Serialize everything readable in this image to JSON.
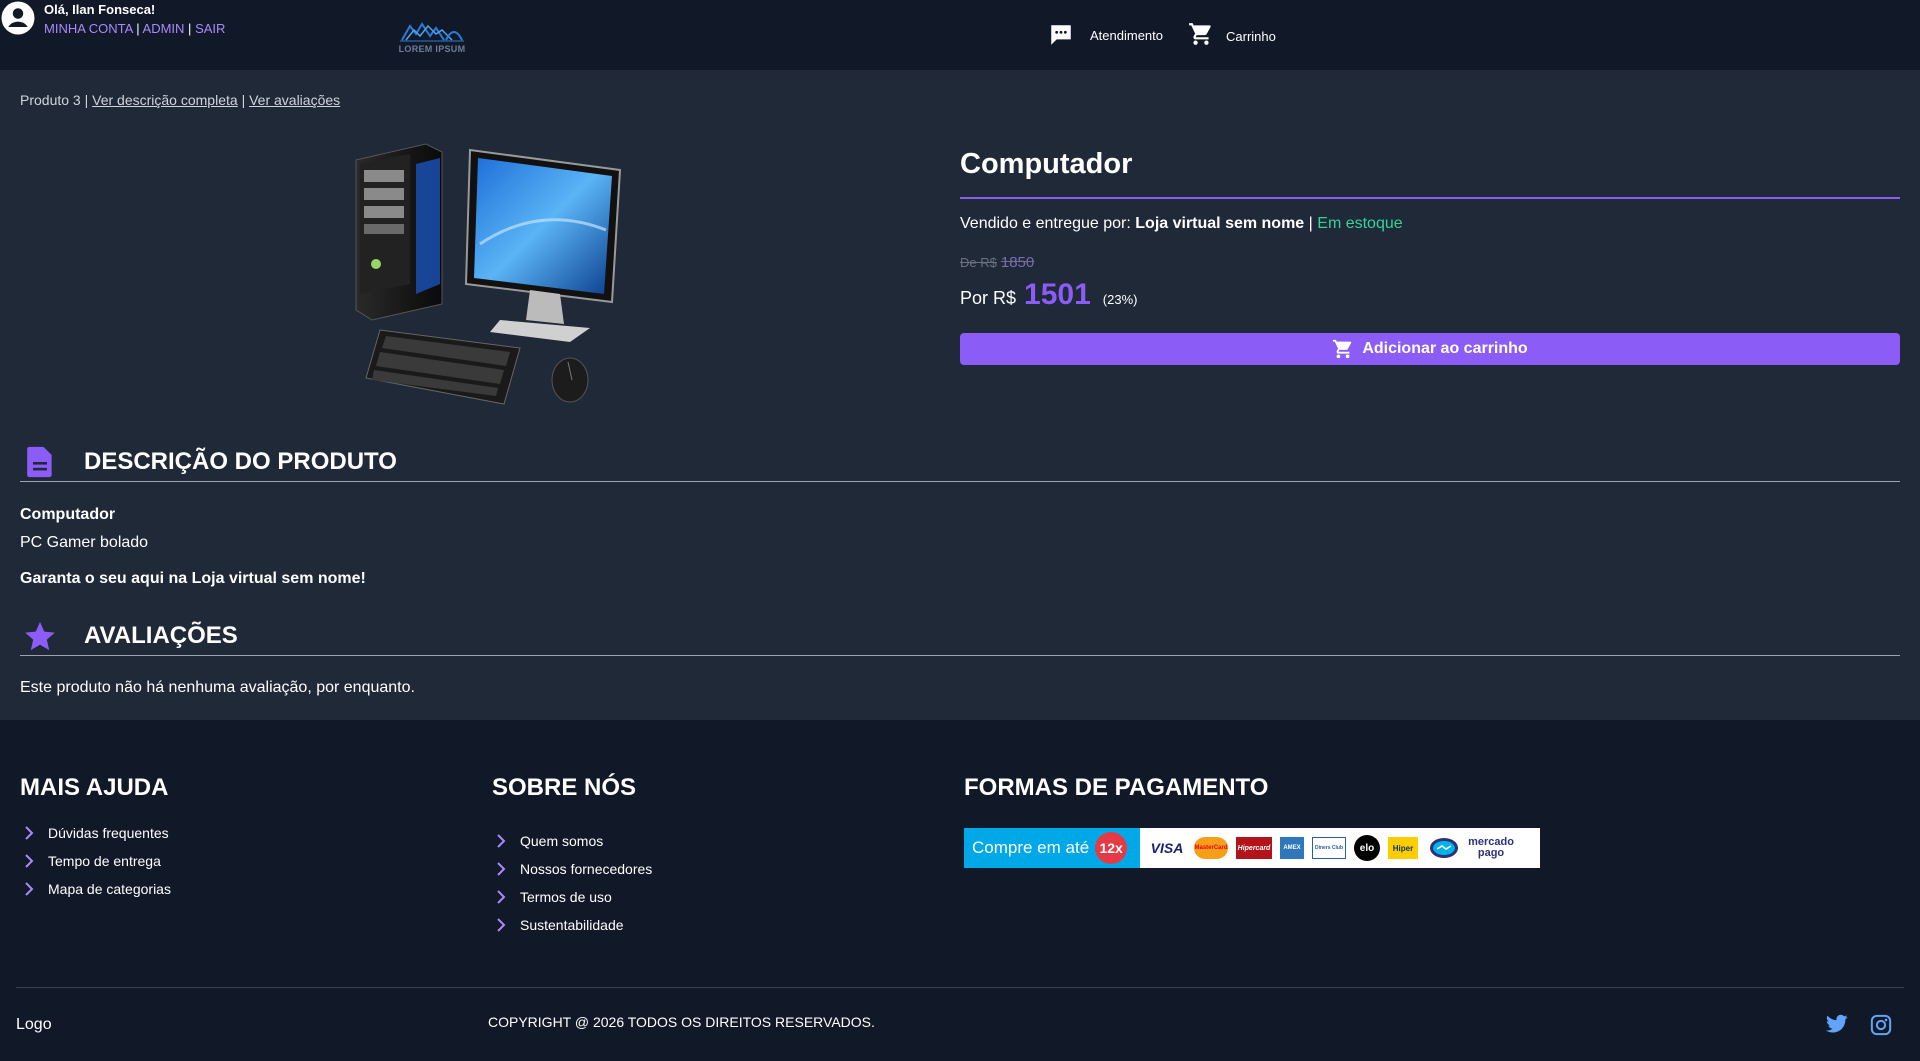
{
  "header": {
    "logo_text": "LOREM IPSUM",
    "support_label": "Atendimento",
    "cart_label": "Carrinho",
    "greeting": "Olá, Ilan Fonseca!",
    "account_link": "MINHA CONTA",
    "admin_link": "ADMIN",
    "logout_link": "SAIR",
    "separator": "|"
  },
  "breadcrumb": {
    "current": "Produto 3",
    "separator": "|",
    "full_description_link": "Ver descrição completa",
    "reviews_link": "Ver avaliações"
  },
  "product": {
    "title": "Computador",
    "seller_prefix": "Vendido e entregue por:",
    "seller_name": "Loja virtual sem nome",
    "separator": "|",
    "stock_status": "Em estoque",
    "old_price_prefix": "De R$",
    "old_price": "1850",
    "new_price_prefix": "Por R$",
    "new_price": "1501",
    "discount": "(23%)",
    "add_to_cart_label": "Adicionar ao carrinho"
  },
  "description": {
    "heading": "DESCRIÇÃO DO PRODUTO",
    "name": "Computador",
    "text": "PC Gamer bolado",
    "tagline": "Garanta o seu aqui na Loja virtual sem nome!"
  },
  "reviews": {
    "heading": "AVALIAÇÕES",
    "empty_text": "Este produto não há nenhuma avaliação, por enquanto."
  },
  "footer": {
    "help": {
      "title": "MAIS AJUDA",
      "items": [
        "Dúvidas frequentes",
        "Tempo de entrega",
        "Mapa de categorias"
      ]
    },
    "about": {
      "title": "SOBRE NÓS",
      "items": [
        "Quem somos",
        "Nossos fornecedores",
        "Termos de uso",
        "Sustentabilidade"
      ]
    },
    "payment": {
      "title": "FORMAS DE PAGAMENTO",
      "banner_text": "Compre em até",
      "installments": "12x",
      "brands": [
        "VISA",
        "MasterCard",
        "Hipercard",
        "AMEX",
        "Diners Club",
        "elo",
        "Hiper",
        "mercado pago"
      ]
    },
    "logo": "Logo",
    "copyright": "COPYRIGHT @ 2026 TODOS OS DIREITOS RESERVADOS."
  },
  "colors": {
    "header_bg": "#111827",
    "page_bg": "#1f2937",
    "accent": "#8b5cf6",
    "link": "#a78bfa",
    "stock": "#34d399",
    "social": "#60a5fa"
  },
  "icons": {
    "support": "chat-bubble-icon",
    "cart": "cart-icon",
    "user": "account-circle-icon",
    "description": "document-icon",
    "reviews": "star-icon",
    "list": "chevron-right-icon",
    "twitter": "twitter-icon",
    "instagram": "instagram-icon"
  }
}
